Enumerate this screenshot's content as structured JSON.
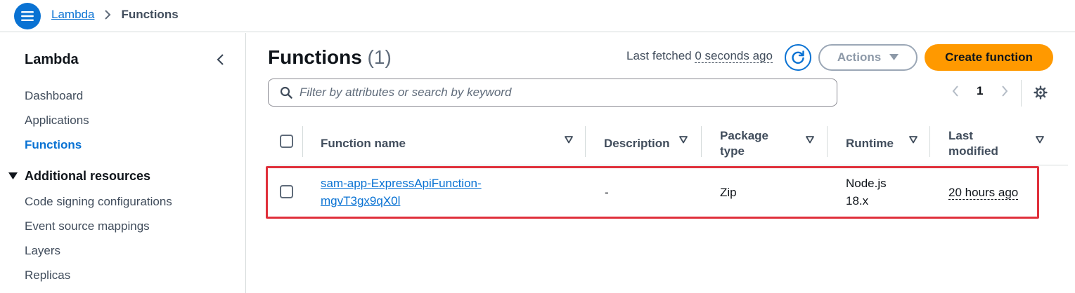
{
  "breadcrumb": {
    "parent": "Lambda",
    "current": "Functions"
  },
  "sidebar": {
    "title": "Lambda",
    "items": [
      {
        "label": "Dashboard",
        "active": false
      },
      {
        "label": "Applications",
        "active": false
      },
      {
        "label": "Functions",
        "active": true
      }
    ],
    "section": {
      "label": "Additional resources",
      "items": [
        {
          "label": "Code signing configurations"
        },
        {
          "label": "Event source mappings"
        },
        {
          "label": "Layers"
        },
        {
          "label": "Replicas"
        }
      ]
    }
  },
  "main": {
    "title": "Functions",
    "count": "(1)",
    "last_fetched_label": "Last fetched",
    "last_fetched_time": "0 seconds ago",
    "actions_label": "Actions",
    "create_label": "Create function",
    "search_placeholder": "Filter by attributes or search by keyword",
    "page_number": "1"
  },
  "table": {
    "columns": [
      {
        "label": "Function name"
      },
      {
        "label": "Description"
      },
      {
        "label": "Package type"
      },
      {
        "label": "Runtime"
      },
      {
        "label": "Last modified"
      }
    ],
    "rows": [
      {
        "function_name_line1": "sam-app-ExpressApiFunction-",
        "function_name_line2": "mgvT3gx9qX0l",
        "description": "-",
        "package_type": "Zip",
        "runtime_line1": "Node.js",
        "runtime_line2": "18.x",
        "last_modified": "20 hours ago"
      }
    ]
  },
  "colors": {
    "accent": "#0972d3",
    "primary_button": "#ff9900",
    "highlight_border": "#e0303b"
  }
}
